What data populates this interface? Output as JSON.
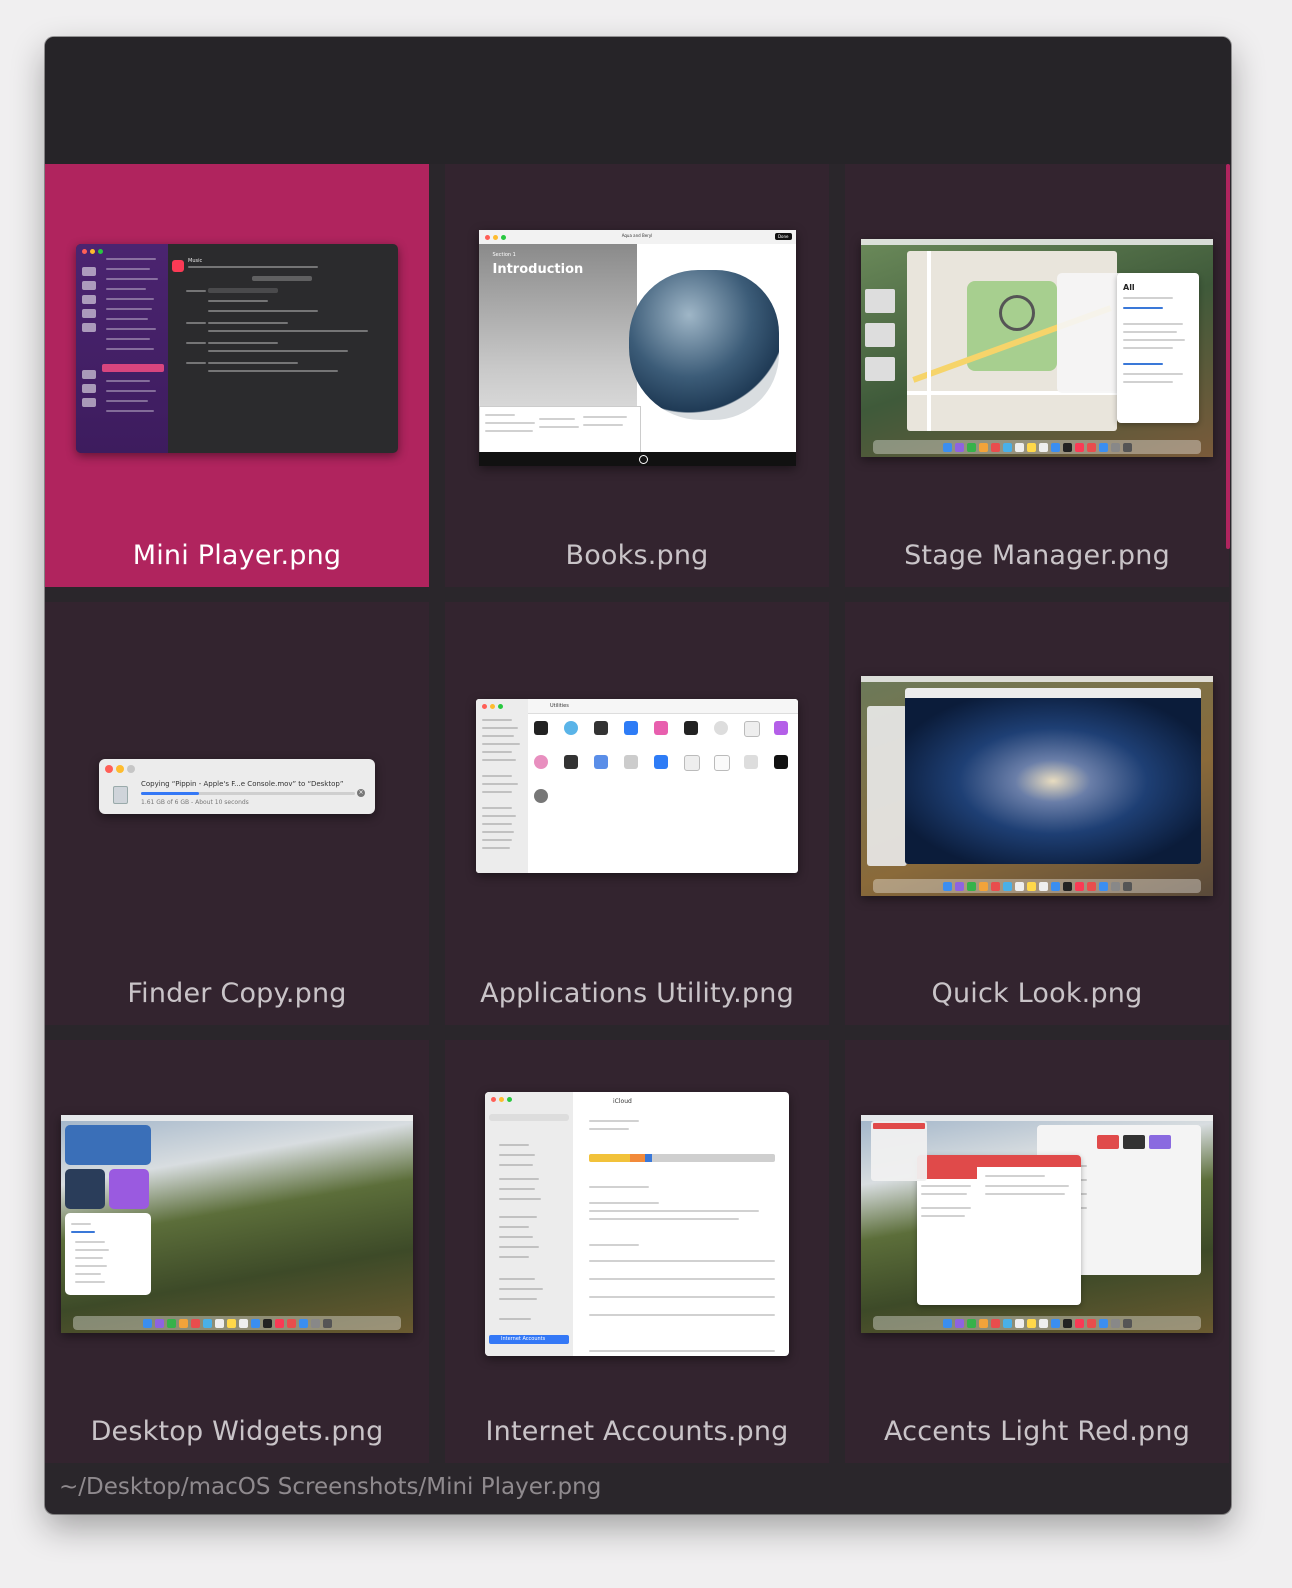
{
  "window": {
    "path": "~/Desktop/macOS Screenshots/Mini Player.png",
    "accent_color": "#b0245e",
    "selected_file": "Mini Player.png"
  },
  "files": [
    {
      "name": "Mini Player.png",
      "selected": true
    },
    {
      "name": "Books.png",
      "selected": false
    },
    {
      "name": "Stage Manager.png",
      "selected": false
    },
    {
      "name": "Finder Copy.png",
      "selected": false
    },
    {
      "name": "Applications Utility.png",
      "selected": false
    },
    {
      "name": "Quick Look.png",
      "selected": false
    },
    {
      "name": "Desktop Widgets.png",
      "selected": false
    },
    {
      "name": "Internet Accounts.png",
      "selected": false
    },
    {
      "name": "Accents Light Red.png",
      "selected": false
    }
  ],
  "thumbs": {
    "mini_player": {
      "title": "Music"
    },
    "books": {
      "section": "Section 1",
      "heading": "Introduction",
      "book_title": "Aqua and Beryl",
      "done_label": "Done"
    },
    "stage_manager": {
      "list_title": "All"
    },
    "finder_copy": {
      "message": "Copying “Pippin - Apple's F...e Console.mov” to “Desktop”",
      "progress_text": "1.61 GB of 6 GB - About 10 seconds",
      "progress": 0.27
    },
    "applications_utility": {
      "folder_title": "Utilities"
    },
    "internet_accounts": {
      "pane_title": "iCloud",
      "selected_item": "Internet Accounts"
    }
  }
}
